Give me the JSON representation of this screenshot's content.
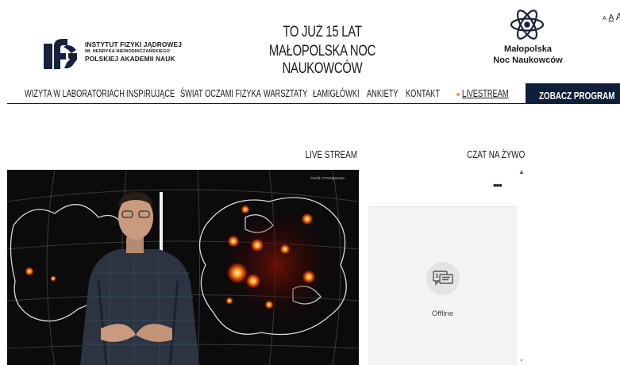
{
  "header": {
    "institute_logo": {
      "line1": "INSTYTUT FIZYKI JĄDROWEJ",
      "line2": "IM. HENRYKA NIEWODNICZAŃSKIEGO",
      "line3": "POLSKIEJ AKADEMII NAUK",
      "icon": "ifj-logo-icon"
    },
    "title_line1": "TO JUŻ 15 LAT",
    "title_line2": "MAŁOPOLSKA NOC NAUKOWCÓW",
    "event_logo": {
      "icon": "atom-icon",
      "line1": "Małopolska",
      "line2": "Noc Naukowców"
    },
    "font_size_controls": [
      "A",
      "A",
      "A"
    ]
  },
  "nav": {
    "items": [
      {
        "label": "WIZYTA W LABORATORIACH"
      },
      {
        "label": "INSPIRUJĄCE"
      },
      {
        "label": "ŚWIAT OCZAMI FIZYKA"
      },
      {
        "label": "WARSZTATY"
      },
      {
        "label": "ŁAMIGŁÓWKI"
      },
      {
        "label": "ANKIETY"
      },
      {
        "label": "KONTAKT"
      },
      {
        "label": "LIVESTREAM"
      }
    ],
    "program_button": "ZOBACZ PROGRAM",
    "live_dot_color": "#e8a21c",
    "button_color": "#0f1f3a"
  },
  "main": {
    "live_stream_label": "LIVE STREAM",
    "chat_label": "CZAT NA ŻYWO",
    "video": {
      "credit": "Credit: CTAO/gamma"
    },
    "chat": {
      "menu_icon": "more-dots-icon",
      "status_icon": "chat-bubble-icon",
      "status": "Offline"
    }
  }
}
